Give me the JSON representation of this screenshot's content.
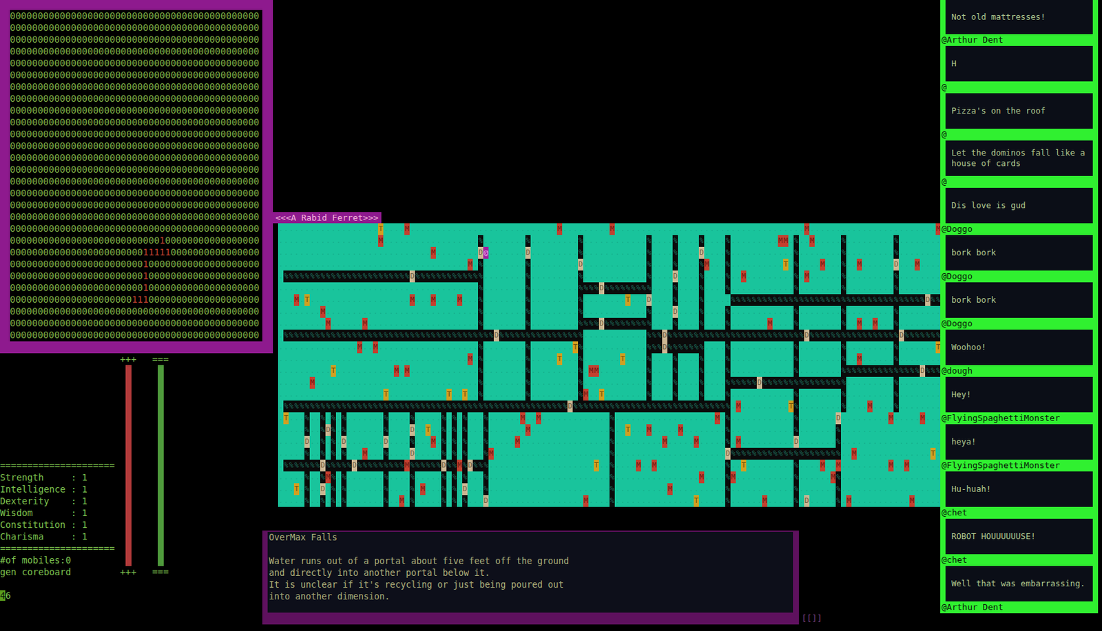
{
  "coreboard": {
    "rows": [
      "000000000000000000000000000000000000000000000",
      "000000000000000000000000000000000000000000000",
      "000000000000000000000000000000000000000000000",
      "000000000000000000000000000000000000000000000",
      "000000000000000000000000000000000000000000000",
      "000000000000000000000000000000000000000000000",
      "000000000000000000000000000000000000000000000",
      "000000000000000000000000000000000000000000000",
      "000000000000000000000000000000000000000000000",
      "000000000000000000000000000000000000000000000",
      "000000000000000000000000000000000000000000000",
      "000000000000000000000000000000000000000000000",
      "000000000000000000000000000000000000000000000",
      "000000000000000000000000000000000000000000000",
      "000000000000000000000000000000000000000000000",
      "000000000000000000000000000000000000000000000",
      "000000000000000000000000000000000000000000000",
      "000000000000000000000000000000000000000000000",
      "000000000000000000000000000000000000000000000",
      "000000000000000000000000000100000000000000000",
      "000000000000000000000000111110000000000000000",
      "000000000000000000000000100000000000000000000",
      "000000000000000000000000100000000000000000000",
      "000000000000000000000000100000000000000000000",
      "000000000000000000000011100000000000000000000",
      "000000000000000000000000000000000000000000000",
      "000000000000000000000000000000000000000000000",
      "000000000000000000000000000000000000000000000"
    ]
  },
  "meters": [
    {
      "top_label": "+++",
      "bottom_label": "+++",
      "level": 1,
      "color": "#b23a3a"
    },
    {
      "top_label": "===",
      "bottom_label": "===",
      "level": 1,
      "color": "#4f9a3c"
    }
  ],
  "stats": {
    "lines": [
      "=====================",
      "Strength     : 1",
      "Intelligence : 1",
      "Dexterity    : 1",
      "Wisdom       : 1",
      "Constitution : 1",
      "Charisma     : 1",
      "=====================",
      "#of mobiles:0",
      "gen coreboard"
    ],
    "prompt": "46"
  },
  "map": {
    "title": "<<<A Rabid Ferret>>>",
    "tile_colors": {
      "floor": "#19c49c",
      "wall": "#0b0b0b",
      "door": "#cdb894",
      "item": "#d1a021",
      "monster": "#c4402f",
      "player": "#a01ea0"
    },
    "rows": [
      "...................T....M............................M.........M....................................M........................M",
      "...................M..................%........%.........%............%....%....%....%.........MM.%..M.....%.........%........",
      ".............................M........D@.......D.........%............%....%....D....%............%........%.........%........",
      "....................................M.%........%.........D............%....%....%M...%..........T.%....M...%..M......D...M....",
      ".%%%%%%%%%%%%%%%%%%%%%%%%D%%%%%%%%%%%%%........%.........%............%....D....%....%..M.........%.M......%.........%........",
      "......................................%........%.........%%%%D%%%%%%%%%....%....%....%............%........%.........%........",
      "...M.T...................M...M....M...%........%.........%........T...D....%....%.....%%%%%%%%%%%%%%%%%%%%%%%%%%%%%%%%%%%%%D%%%",
      "........M.............................%........%.........%............%....D....%....%............%........%.........%........",
      ".........M......M.....................%........%.........%%%%D%%%%%%%%%....%....%....%.......M....%........%..M..M...%........",
      ".%%%%%%%%%%%%%%%%%%%%%%%%%%%%%%%%%%%%%%%%D%%%%%%%%%%%%%%%%............%%%D%%%%%%%%%%%%%%%%%%%%%%%%%%D%%%%%%%%%%%%%%%%%D%%%%%%%",
      "...............M..M...................%........%........T%............%%%D%%%%%%%....%............%........%.........%.......T",
      "....................................M.%........%.....T...%.......T....%....%....%....%............%........%..M......%........",
      "..........T...........M.M.............%........%.........%.MM.........%....%....%....%............%........%%%%%%%%%%%%%%%D%%%",
      "......M...............................%........%.........%............%....%....%....%%%%%%D%%%%%%%%%%%%%%%%.........%........",
      "....................T...........T..T..%........%.........%M..T........%....%....%....%............%........%.........%........",
      ".%%%%%%%%%%%%%%%%%%%%%%%%%%%%%%%%%%%%%%%%%%%%%%%%%%%%%%D%%%%%%%%%%%%%%%%%%%%%%%%%%%%%%.M.........T%........%....M....%........",
      ".T...%..%.%.%.......%....%.....%.%.%...%......M..M.............%...................M.%............%.......D.........M.....M...",
      ".....%..%D%.%.......%....D..T..%.%.%...%.......M...............%..T...M.....M........%............%.......%...................",
      ".....D..%.%.D.......D....%...M.%.%.%...%.....M.................%.........M.....M.....%.M..........D.......%...................",
      ".....%..%.%.%...M...%....D.....%.%.%...%M......................%.....................D%%%%%%%%%%%%%%%%%%%%%..M..............T.",
      ".%%%%%%%D%%%%%D%%%%%%%%%M%%%%%%D%%M%D%%%....................T..%....M..M.............%..T.........%....M..M.........M..M......",
      ".....%..%M%.%.......%....%.....%.%.%...%.......................%................M....%M...........%......M%...................",
      "...T.%..D.%.%.......%....%.M...%.%.D...%.......................%..........M..........%............%.......%...................",
      ".....%..%.%.%.......%..M.%.....%.%.%...D..................M....%...............T.....%......M.....%.D.....%.M...........M....."
    ]
  },
  "location": {
    "title": "OverMax Falls",
    "lines": [
      "Water runs out of a portal about five feet off the ground",
      "and directly into another portal below it.",
      "It is unclear if it's recycling or just being poured out",
      "into another dimension."
    ]
  },
  "corner": "[[]]",
  "chat": {
    "items": [
      {
        "kind": "message",
        "text": "Not old mattresses!"
      },
      {
        "kind": "author",
        "text": "@Arthur Dent"
      },
      {
        "kind": "message",
        "text": "H"
      },
      {
        "kind": "author",
        "text": "@"
      },
      {
        "kind": "message",
        "text": "Pizza's on the roof"
      },
      {
        "kind": "author",
        "text": "@"
      },
      {
        "kind": "message",
        "text": "Let the dominos fall like a house of cards"
      },
      {
        "kind": "author",
        "text": "@"
      },
      {
        "kind": "message",
        "text": "Dis love is gud"
      },
      {
        "kind": "author",
        "text": "@Doggo"
      },
      {
        "kind": "message",
        "text": "bork bork"
      },
      {
        "kind": "author",
        "text": "@Doggo"
      },
      {
        "kind": "message",
        "text": "bork bork"
      },
      {
        "kind": "author",
        "text": "@Doggo"
      },
      {
        "kind": "message",
        "text": "Woohoo!"
      },
      {
        "kind": "author",
        "text": "@dough"
      },
      {
        "kind": "message",
        "text": "Hey!"
      },
      {
        "kind": "author",
        "text": "@FlyingSpaghettiMonster"
      },
      {
        "kind": "message",
        "text": "heya!"
      },
      {
        "kind": "author",
        "text": "@FlyingSpaghettiMonster"
      },
      {
        "kind": "message",
        "text": "Hu-huah!"
      },
      {
        "kind": "author",
        "text": "@chet"
      },
      {
        "kind": "message",
        "text": "ROBOT HOUUUUUUSE!"
      },
      {
        "kind": "author",
        "text": "@chet"
      },
      {
        "kind": "message",
        "text": "Well that was embarrassing."
      },
      {
        "kind": "author",
        "text": "@Arthur Dent"
      }
    ]
  }
}
